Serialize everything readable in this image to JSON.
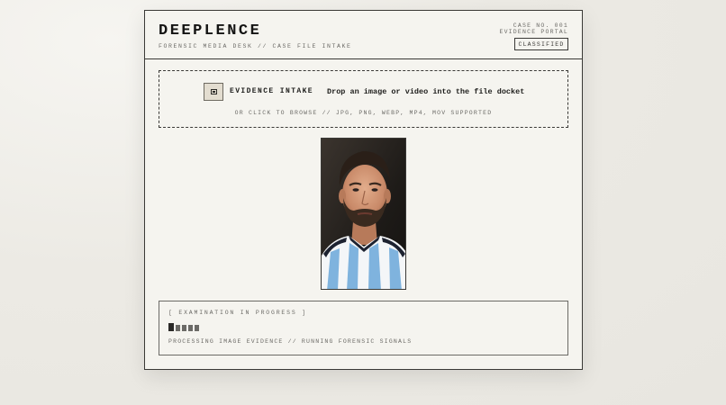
{
  "header": {
    "brand": "DEEPLENCE",
    "subtitle": "FORENSIC MEDIA DESK // CASE FILE INTAKE",
    "case_no": "CASE NO. 001",
    "portal": "EVIDENCE PORTAL",
    "badge": "CLASSIFIED"
  },
  "dropzone": {
    "icon": "file-icon",
    "title": "EVIDENCE INTAKE",
    "description": "Drop an image or video into the file docket",
    "hint": "OR CLICK TO BROWSE // JPG, PNG, WEBP, MP4, MOV SUPPORTED"
  },
  "evidence": {
    "image": "portrait-photo"
  },
  "status": {
    "title": "[ EXAMINATION IN PROGRESS ]",
    "progress_segments_active": 1,
    "progress_segments_total": 5,
    "detail": "PROCESSING IMAGE EVIDENCE // RUNNING FORENSIC SIGNALS"
  }
}
